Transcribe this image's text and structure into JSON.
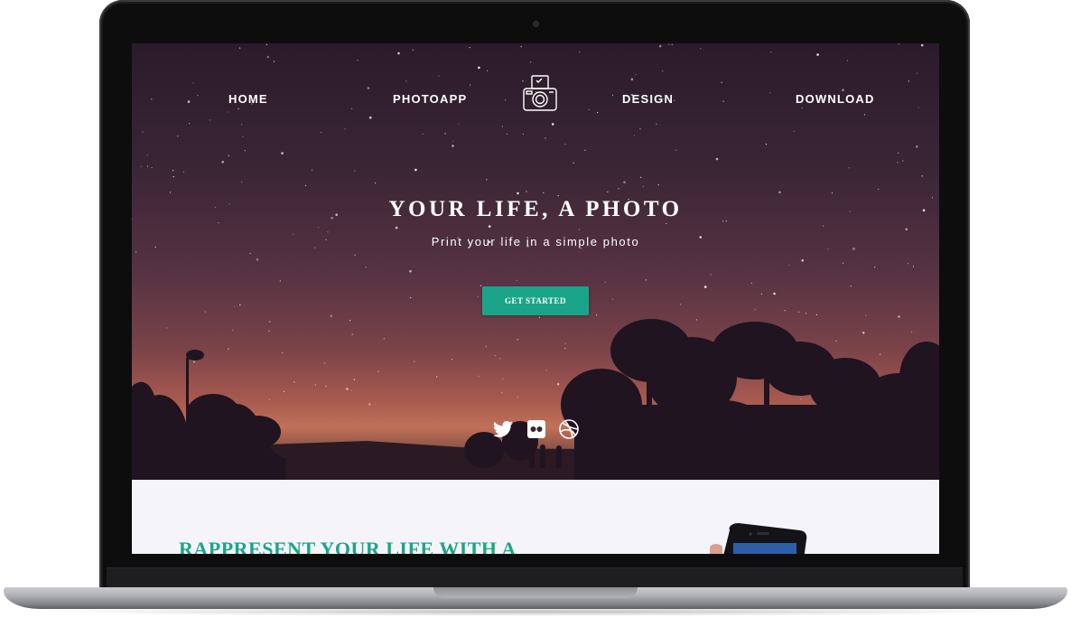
{
  "nav": {
    "items": [
      {
        "label": "HOME"
      },
      {
        "label": "PHOTOAPP"
      },
      {
        "label": "DESIGN"
      },
      {
        "label": "DOWNLOAD"
      }
    ]
  },
  "hero": {
    "title": "YOUR LIFE, A PHOTO",
    "subtitle": "Print your life in a simple photo",
    "cta_label": "GET STARTED"
  },
  "social": {
    "icons": [
      "twitter-icon",
      "flickr-icon",
      "dribbble-icon"
    ]
  },
  "section": {
    "heading": "RAPPRESENT YOUR LIFE WITH A"
  },
  "colors": {
    "accent": "#1aa58a",
    "hero_top": "#2a1b2b",
    "hero_glow": "#c07158",
    "section_bg": "#f5f4f9"
  }
}
